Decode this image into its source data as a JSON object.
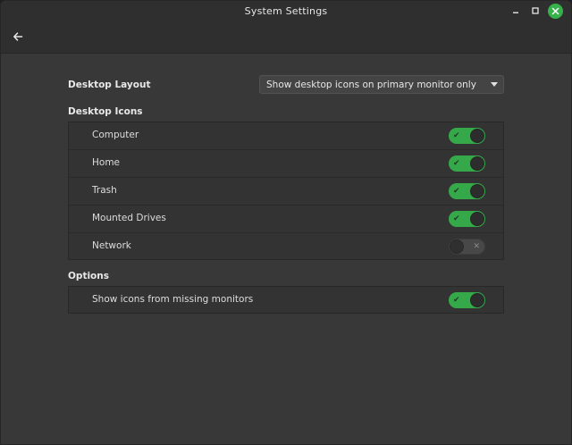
{
  "window": {
    "title": "System Settings"
  },
  "desktop_layout": {
    "label": "Desktop Layout",
    "selected": "Show desktop icons on primary monitor only"
  },
  "desktop_icons": {
    "header": "Desktop Icons",
    "items": [
      {
        "label": "Computer",
        "enabled": true
      },
      {
        "label": "Home",
        "enabled": true
      },
      {
        "label": "Trash",
        "enabled": true
      },
      {
        "label": "Mounted Drives",
        "enabled": true
      },
      {
        "label": "Network",
        "enabled": false
      }
    ]
  },
  "options": {
    "header": "Options",
    "items": [
      {
        "label": "Show icons from missing monitors",
        "enabled": true
      }
    ]
  },
  "colors": {
    "accent": "#35a94a",
    "window_bg": "#383838",
    "titlebar_bg": "#2f2f2f",
    "panel_bg": "#333333"
  },
  "icons": {
    "back": "arrow-left-icon",
    "minimize": "minimize-icon",
    "maximize": "maximize-icon",
    "close": "close-icon",
    "toggle_on": "check-icon",
    "toggle_off": "x-icon"
  }
}
